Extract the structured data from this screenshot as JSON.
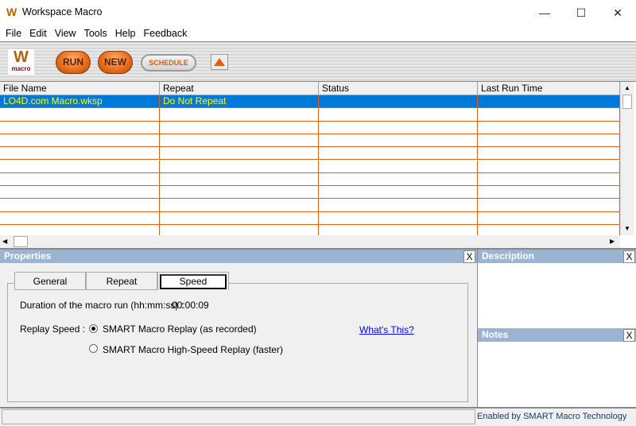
{
  "window": {
    "title": "Workspace Macro",
    "minimize": "—",
    "maximize": "☐",
    "close": "✕"
  },
  "menu": [
    "File",
    "Edit",
    "View",
    "Tools",
    "Help",
    "Feedback"
  ],
  "toolbar": {
    "logo_text": "macro",
    "run": "RUN",
    "new": "NEW",
    "schedule": "SCHEDULE",
    "up_icon": "triangle-up-icon"
  },
  "grid": {
    "columns": [
      "File Name",
      "Repeat",
      "Status",
      "Last Run Time"
    ],
    "rows": [
      {
        "file": "LO4D.com Macro.wksp",
        "repeat": "Do Not Repeat",
        "status": "",
        "last_run": ""
      }
    ],
    "empty_rows": 10
  },
  "properties": {
    "title": "Properties",
    "close": "X",
    "tabs": [
      "General",
      "Repeat",
      "Speed"
    ],
    "active_tab": "Speed",
    "duration_label": "Duration of the macro run (hh:mm:ss) :",
    "duration_value": "00:00:09",
    "replay_label": "Replay Speed :",
    "options": [
      "SMART Macro Replay (as recorded)",
      "SMART Macro High-Speed Replay (faster)"
    ],
    "selected_option": 0,
    "whats_this": "What's This?"
  },
  "description": {
    "title": "Description",
    "close": "X"
  },
  "notes": {
    "title": "Notes",
    "close": "X"
  },
  "status": {
    "text": "Enabled by SMART Macro Technology"
  },
  "colors": {
    "accent": "#0078d7",
    "grid_lines": "#e06010",
    "panel_header": "#9ab4d2",
    "selected_text": "#ffff00"
  }
}
